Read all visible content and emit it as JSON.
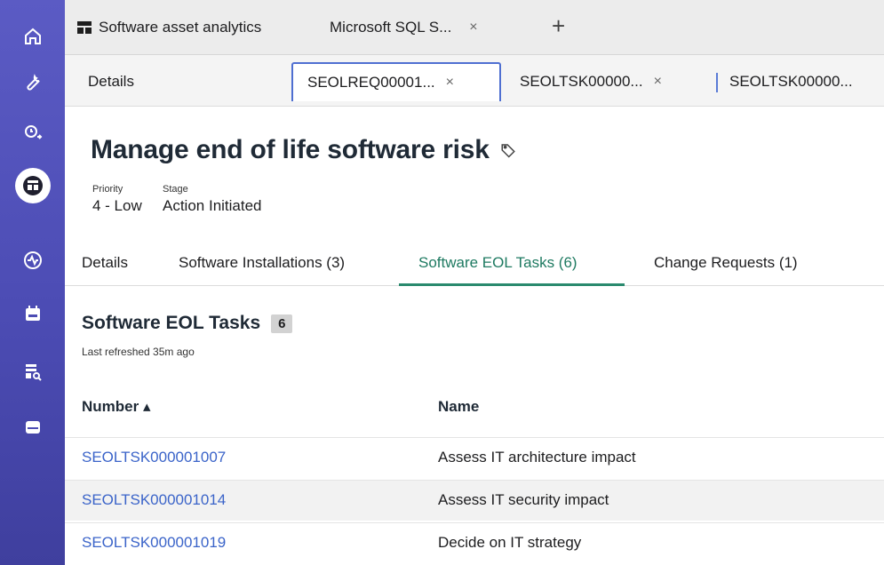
{
  "workspace_tabs": [
    {
      "label": "Software asset analytics",
      "icon": "dashboard-icon"
    },
    {
      "label": "Microsoft SQL S...",
      "close": "×"
    }
  ],
  "add_tab_symbol": "+",
  "record_tabs": [
    {
      "label": "Details"
    },
    {
      "label": "SEOLREQ00001...",
      "close": "×"
    },
    {
      "label": "SEOLTSK00000...",
      "close": "×"
    },
    {
      "label": "SEOLTSK00000..."
    }
  ],
  "record": {
    "title": "Manage end of life software risk",
    "priority_label": "Priority",
    "priority_value": "4 - Low",
    "stage_label": "Stage",
    "stage_value": "Action Initiated"
  },
  "content_tabs": [
    {
      "label": "Details"
    },
    {
      "label": "Software Installations (3)"
    },
    {
      "label": "Software EOL Tasks (6)",
      "active": true
    },
    {
      "label": "Change Requests (1)"
    }
  ],
  "list": {
    "title": "Software EOL Tasks",
    "count": "6",
    "last_refreshed": "Last refreshed 35m ago",
    "columns": [
      "Number ▴",
      "Name"
    ],
    "rows": [
      {
        "number": "SEOLTSK000001007",
        "name": "Assess IT architecture impact"
      },
      {
        "number": "SEOLTSK000001014",
        "name": "Assess IT security impact"
      },
      {
        "number": "SEOLTSK000001019",
        "name": "Decide on IT strategy"
      }
    ]
  },
  "colors": {
    "rail": "#4c4cb4",
    "link": "#3b64c9",
    "active_tab": "#1e7a61",
    "focused_tab_border": "#4f6fd1"
  }
}
